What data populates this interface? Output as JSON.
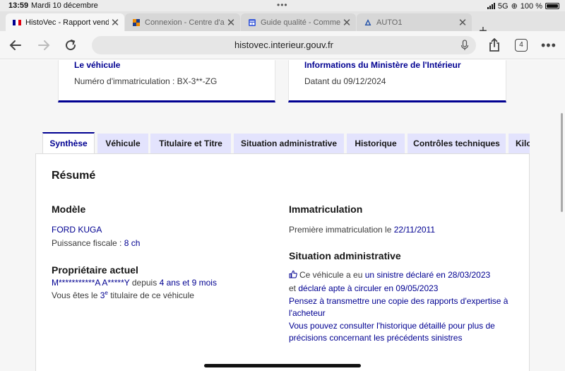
{
  "status": {
    "time": "13:59",
    "date": "Mardi 10 décembre",
    "network": "5G",
    "battery": "100 %"
  },
  "browser": {
    "tabs": [
      {
        "title": "HistoVec - Rapport vendeur",
        "active": true,
        "favicon": "french-flag-icon"
      },
      {
        "title": "Connexion - Centre d'administration",
        "active": false,
        "favicon": "orange-squares-icon"
      },
      {
        "title": "Guide qualité - Comment",
        "active": false,
        "favicon": "document-icon"
      },
      {
        "title": "AUTO1",
        "active": false,
        "favicon": "auto1-icon"
      }
    ],
    "url": "histovec.interieur.gouv.fr",
    "tab_count": "4"
  },
  "cards": {
    "vehicule": {
      "title": "Le véhicule",
      "text": "Numéro d'immatriculation : BX-3**-ZG"
    },
    "ministere": {
      "title": "Informations du Ministère de l'Intérieur",
      "text": "Datant du 09/12/2024"
    }
  },
  "report_tabs": [
    {
      "label": "Synthèse",
      "active": true
    },
    {
      "label": "Véhicule",
      "active": false
    },
    {
      "label": "Titulaire et Titre",
      "active": false
    },
    {
      "label": "Situation administrative",
      "active": false
    },
    {
      "label": "Historique",
      "active": false
    },
    {
      "label": "Contrôles techniques",
      "active": false
    },
    {
      "label": "Kilo",
      "active": false
    }
  ],
  "summary": {
    "title": "Résumé",
    "modele": {
      "heading": "Modèle",
      "name": "FORD KUGA",
      "puissance_label": "Puissance fiscale : ",
      "puissance_value": "8 ch"
    },
    "proprietaire": {
      "heading": "Propriétaire actuel",
      "name": "M***********A A*****Y",
      "depuis": " depuis ",
      "duration": "4 ans et 9 mois",
      "rank_prefix": "Vous êtes le ",
      "rank_num": "3",
      "rank_sup": "e",
      "rank_suffix": " titulaire de ce véhicule"
    },
    "immatriculation": {
      "heading": "Immatriculation",
      "label": "Première immatriculation le ",
      "date": "22/11/2011"
    },
    "situation": {
      "heading": "Situation administrative",
      "line1_prefix": "Ce véhicule a eu ",
      "line1_link": "un sinistre déclaré en 28/03/2023",
      "line2_prefix": "et ",
      "line2_link": "déclaré apte à circuler en 09/05/2023",
      "advice1_a": "Pensez à transmettre une copie des rapports d'expertise à",
      "advice1_b": "l'acheteur",
      "advice2_a": "Vous pouvez consulter l'historique détaillé pour plus de",
      "advice2_b": "précisions concernant les précédents sinistres"
    }
  },
  "colors": {
    "accent": "#000091",
    "tab_bg": "#e3e3fd"
  }
}
